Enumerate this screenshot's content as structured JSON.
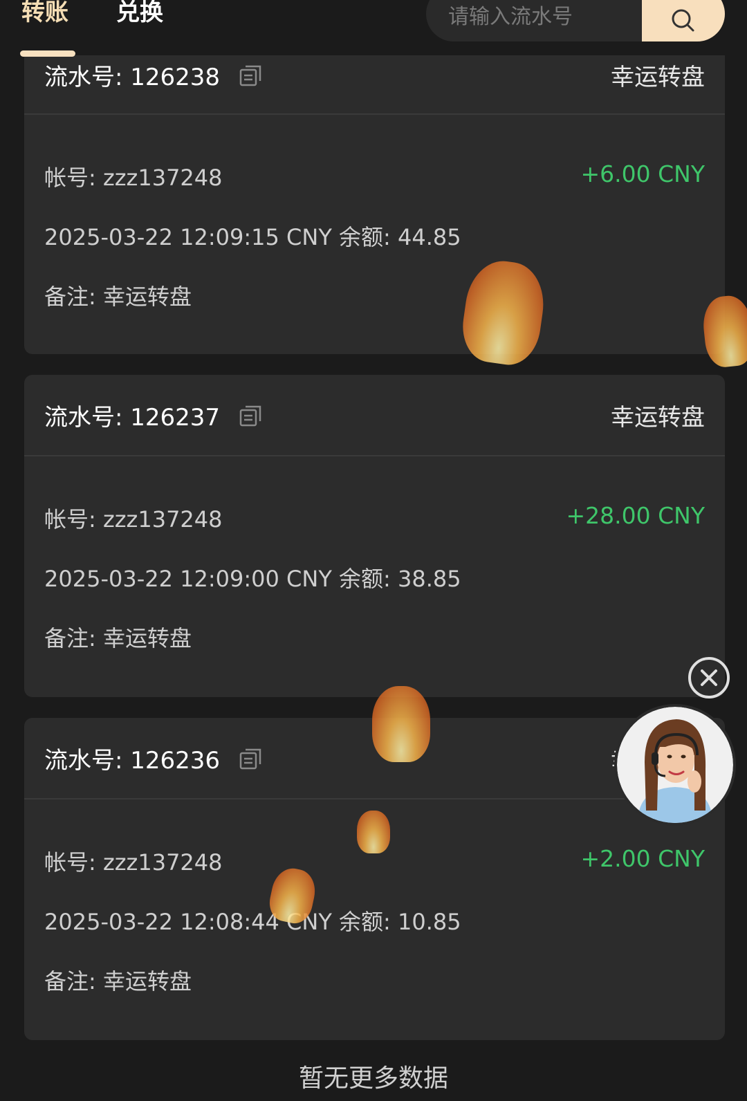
{
  "tabs": [
    {
      "label": "转账",
      "active": true
    },
    {
      "label": "兑换",
      "active": false
    }
  ],
  "search": {
    "placeholder": "请输入流水号"
  },
  "records": [
    {
      "serial": "流水号: 126238",
      "type": "幸运转盘",
      "account": "帐号: zzz137248",
      "amount": "+6.00 CNY",
      "time_balance": "2025-03-22 12:09:15 CNY 余额: 44.85",
      "remark": "备注: 幸运转盘"
    },
    {
      "serial": "流水号: 126237",
      "type": "幸运转盘",
      "account": "帐号: zzz137248",
      "amount": "+28.00 CNY",
      "time_balance": "2025-03-22 12:09:00 CNY 余额: 38.85",
      "remark": "备注: 幸运转盘"
    },
    {
      "serial": "流水号: 126236",
      "type": "幸运转盘",
      "account": "帐号: zzz137248",
      "amount": "+2.00 CNY",
      "time_balance": "2025-03-22 12:08:44 CNY 余额: 10.85",
      "remark": "备注: 幸运转盘"
    }
  ],
  "footer": {
    "no_more": "暂无更多数据"
  },
  "colors": {
    "accent": "#f8dfbd",
    "positive": "#3fc66a",
    "background": "#1b1b1b",
    "card": "#2c2c2c"
  },
  "icons": {
    "search": "search-icon",
    "copy": "copy-icon",
    "close": "close-icon",
    "support": "support-avatar"
  }
}
